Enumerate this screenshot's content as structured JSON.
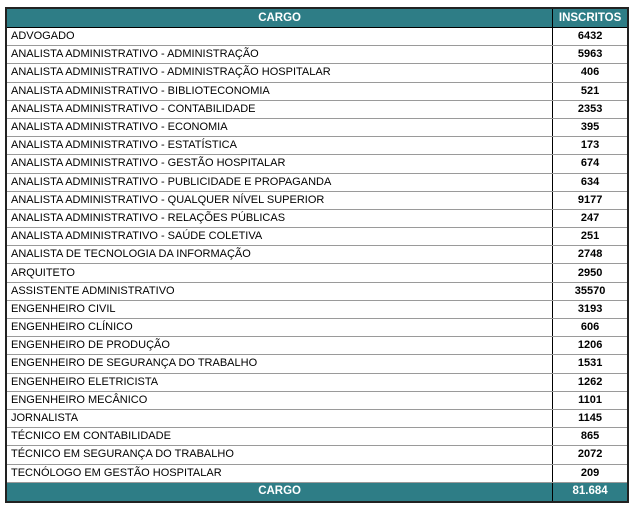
{
  "header": {
    "cargo": "CARGO",
    "inscritos": "INSCRITOS"
  },
  "rows": [
    {
      "cargo": "ADVOGADO",
      "inscritos": "6432"
    },
    {
      "cargo": "ANALISTA ADMINISTRATIVO - ADMINISTRAÇÃO",
      "inscritos": "5963"
    },
    {
      "cargo": "ANALISTA ADMINISTRATIVO - ADMINISTRAÇÃO HOSPITALAR",
      "inscritos": "406"
    },
    {
      "cargo": "ANALISTA ADMINISTRATIVO - BIBLIOTECONOMIA",
      "inscritos": "521"
    },
    {
      "cargo": "ANALISTA ADMINISTRATIVO - CONTABILIDADE",
      "inscritos": "2353"
    },
    {
      "cargo": "ANALISTA ADMINISTRATIVO - ECONOMIA",
      "inscritos": "395"
    },
    {
      "cargo": "ANALISTA ADMINISTRATIVO - ESTATÍSTICA",
      "inscritos": "173"
    },
    {
      "cargo": "ANALISTA ADMINISTRATIVO - GESTÃO HOSPITALAR",
      "inscritos": "674"
    },
    {
      "cargo": "ANALISTA ADMINISTRATIVO - PUBLICIDADE E PROPAGANDA",
      "inscritos": "634"
    },
    {
      "cargo": "ANALISTA ADMINISTRATIVO - QUALQUER NÍVEL SUPERIOR",
      "inscritos": "9177"
    },
    {
      "cargo": "ANALISTA ADMINISTRATIVO - RELAÇÕES PÚBLICAS",
      "inscritos": "247"
    },
    {
      "cargo": "ANALISTA ADMINISTRATIVO - SAÚDE COLETIVA",
      "inscritos": "251"
    },
    {
      "cargo": "ANALISTA DE TECNOLOGIA DA INFORMAÇÃO",
      "inscritos": "2748"
    },
    {
      "cargo": "ARQUITETO",
      "inscritos": "2950"
    },
    {
      "cargo": "ASSISTENTE ADMINISTRATIVO",
      "inscritos": "35570"
    },
    {
      "cargo": "ENGENHEIRO CIVIL",
      "inscritos": "3193"
    },
    {
      "cargo": "ENGENHEIRO CLÍNICO",
      "inscritos": "606"
    },
    {
      "cargo": "ENGENHEIRO DE PRODUÇÃO",
      "inscritos": "1206"
    },
    {
      "cargo": "ENGENHEIRO DE SEGURANÇA DO TRABALHO",
      "inscritos": "1531"
    },
    {
      "cargo": "ENGENHEIRO ELETRICISTA",
      "inscritos": "1262"
    },
    {
      "cargo": "ENGENHEIRO MECÂNICO",
      "inscritos": "1101"
    },
    {
      "cargo": "JORNALISTA",
      "inscritos": "1145"
    },
    {
      "cargo": "TÉCNICO EM CONTABILIDADE",
      "inscritos": "865"
    },
    {
      "cargo": "TÉCNICO EM SEGURANÇA DO TRABALHO",
      "inscritos": "2072"
    },
    {
      "cargo": "TECNÓLOGO EM GESTÃO HOSPITALAR",
      "inscritos": "209"
    }
  ],
  "footer": {
    "label": "CARGO",
    "total": "81.684"
  }
}
